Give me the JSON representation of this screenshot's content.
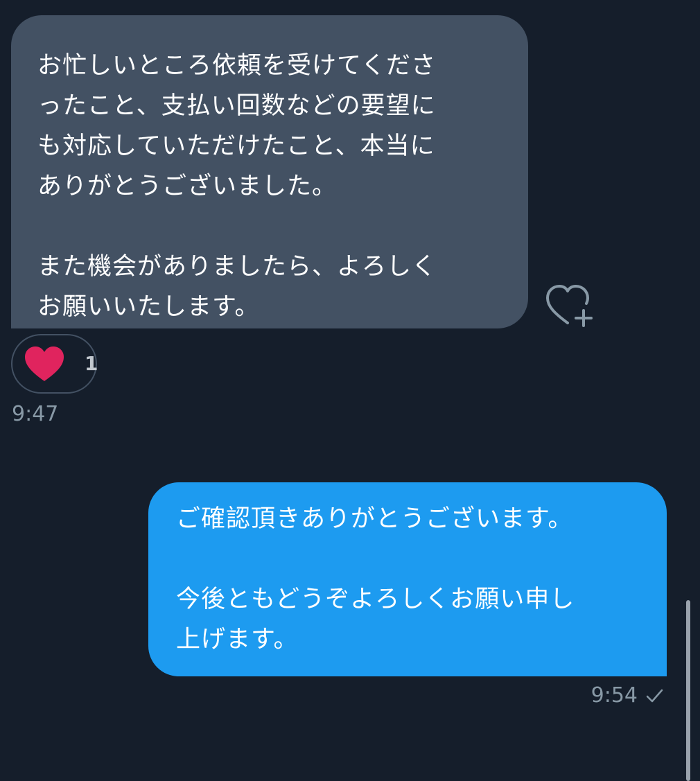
{
  "conversation": {
    "incoming": {
      "paragraph_1": "お忙しいところ依頼を受けてくださったこと、支払い回数などの要望にも対応していただけたこと、本当にありがとうございました。",
      "paragraph_1_lines": [
        "お忙しいところ依頼を受けてくださ",
        "ったこと、支払い回数などの要望に",
        "も対応していただけたこと、本当に",
        "ありがとうございました。"
      ],
      "paragraph_2_lines": [
        "また機会がありましたら、よろしく",
        "お願いいたします。"
      ],
      "reaction": {
        "icon": "heart-icon",
        "count": "1",
        "color": "#e0245e"
      },
      "time": "9:47"
    },
    "outgoing": {
      "paragraph_1_lines": [
        "ご確認頂きありがとうございます。"
      ],
      "paragraph_2_lines": [
        "今後ともどうぞよろしくお願い申し",
        "上げます。"
      ],
      "time": "9:54",
      "status_icon": "check-icon"
    }
  },
  "colors": {
    "background": "#151e2b",
    "incoming_bubble": "#435163",
    "outgoing_bubble": "#1d9bf0",
    "meta_text": "#8899a6"
  }
}
